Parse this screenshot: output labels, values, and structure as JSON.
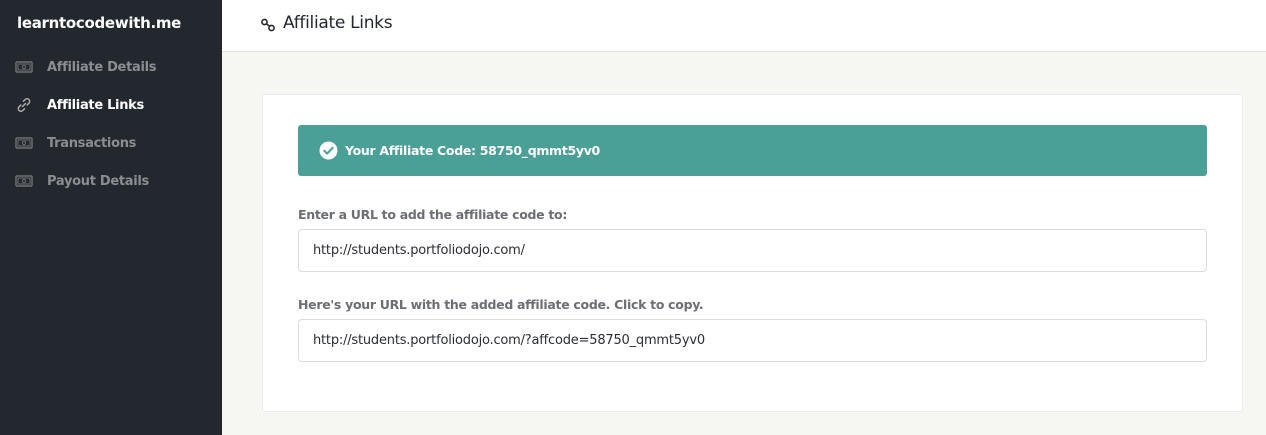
{
  "sidebar": {
    "brand": "learntocodewith.me",
    "items": [
      {
        "label": "Affiliate Details",
        "icon": "money-icon",
        "active": false
      },
      {
        "label": "Affiliate Links",
        "icon": "link-icon",
        "active": true
      },
      {
        "label": "Transactions",
        "icon": "money-icon",
        "active": false
      },
      {
        "label": "Payout Details",
        "icon": "money-icon",
        "active": false
      }
    ]
  },
  "header": {
    "title": "Affiliate Links",
    "icon": "link-icon"
  },
  "main": {
    "alert": {
      "label": "Your Affiliate Code:",
      "code": "58750_qmmt5yv0",
      "icon": "check-circle-icon",
      "color": "#4a9f96"
    },
    "url_input": {
      "label": "Enter a URL to add the affiliate code to:",
      "value": "http://students.portfoliodojo.com/"
    },
    "result_input": {
      "label": "Here's your URL with the added affiliate code. Click to copy.",
      "value": "http://students.portfoliodojo.com/?affcode=58750_qmmt5yv0"
    }
  },
  "colors": {
    "sidebar_bg": "#23272e",
    "accent": "#4a9f96",
    "page_bg": "#f6f6f3"
  }
}
